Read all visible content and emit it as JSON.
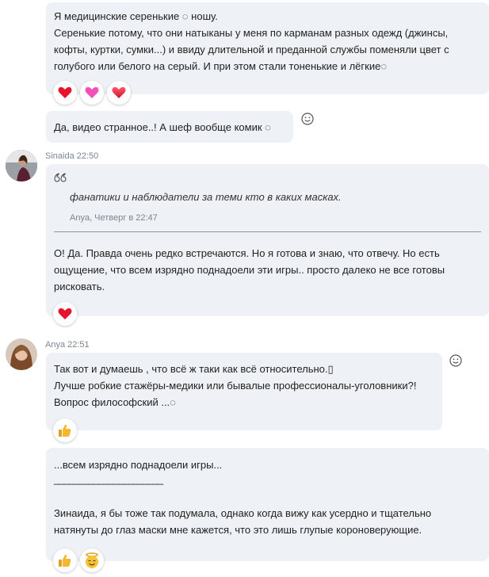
{
  "messages": {
    "m1": {
      "text": "Я медицинские  серенькие ◌ ношу.\nСеренькие потому, что они натыканы у меня по карманам разных одежд (джинсы, кофты, куртки, сумки...) и ввиду длительной и преданной службы поменяли цвет с голубого или белого на серый. И при этом стали тоненькие и лёгкие◌",
      "reactions": [
        "heart-red",
        "heart-pink",
        "heart-gradient"
      ]
    },
    "m2": {
      "text": "Да, видео странное..! А шеф вообще комик ◌"
    },
    "m3": {
      "author": "Sinaida",
      "time": "22:50",
      "quote_mark": "66",
      "quote_text": "фанатики и наблюдатели за теми кто в каких масках.",
      "quote_meta": "Anya, Четверг в 22:47",
      "text": "О! Да. Правда очень редко встречаются. Но я готова и знаю, что отвечу. Но есть ощущение, что всем изрядно поднадоели эти игры.. просто далеко не все готовы рисковать.",
      "reactions": [
        "heart-red"
      ]
    },
    "m4": {
      "author": "Anya",
      "time": "22:51",
      "text": "Так вот и думаешь , что всё ж таки как всё относительно.▯\nЛучше робкие стажёры-медики или бывалые профессионалы-уголовники?!\nВопрос философский ...◌",
      "reactions": [
        "thumbs-up"
      ]
    },
    "m5": {
      "quote_line": "...всем изрядно поднадоели игры...",
      "separator": "______________________",
      "text": "Зинаида, я бы тоже так подумала, однако когда вижу как усердно и тщательно натянуты до глаз маски мне кажется, что это лишь глупые короноверующие.",
      "reactions": [
        "thumbs-up",
        "angel-face"
      ]
    }
  },
  "colors": {
    "bubble": "#eef1f5",
    "heart_red": "#e8142c",
    "heart_pink": "#f24fb8",
    "thumbs": "#f5b731"
  }
}
